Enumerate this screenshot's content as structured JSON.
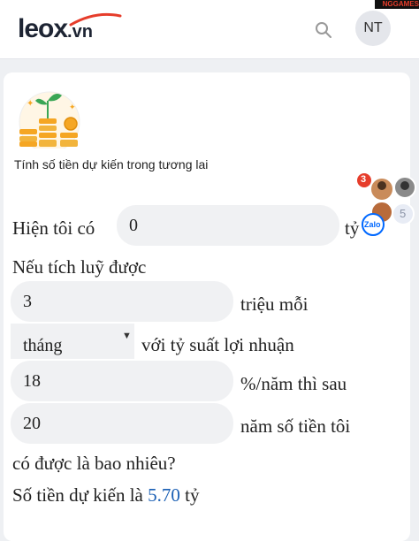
{
  "header": {
    "logo_brand": "leox",
    "logo_tld": ".vn",
    "avatar_initials": "NT",
    "corner_badge": "NGGAMES"
  },
  "calculator": {
    "subtitle": "Tính số tiền dự kiến trong tương lai",
    "label_have": "Hiện tôi có",
    "current_amount": "0",
    "unit_billion": "tỷ",
    "label_if_save": "Nếu tích luỹ được",
    "monthly_amount": "3",
    "label_million_each": "triệu mỗi",
    "period_selected": "tháng",
    "label_profit_rate": "với tỷ suất lợi nhuận",
    "rate": "18",
    "label_rate_suffix": "%/năm thì sau",
    "years": "20",
    "label_years_suffix": "năm số tiền tôi",
    "label_question": "có được là bao nhiêu?",
    "result_prefix": "Số tiền dự kiến là",
    "result_value": "5.70",
    "result_unit": "tỷ"
  },
  "chat_widget": {
    "notification_count": "3",
    "extra_count": "5",
    "zalo_label": "Zalo"
  },
  "colors": {
    "accent_red": "#e63d2b",
    "result_blue": "#1a5fb4",
    "coin_gold": "#f5a623"
  }
}
